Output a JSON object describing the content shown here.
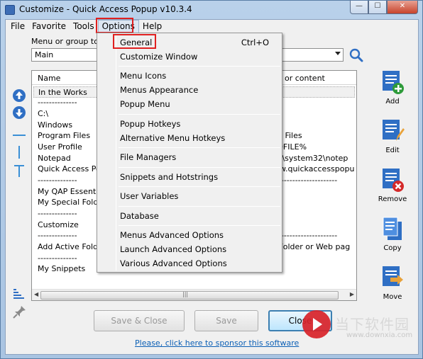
{
  "window": {
    "title": "Customize - Quick Access Popup v10.3.4",
    "min_glyph": "—",
    "max_glyph": "☐",
    "close_glyph": "✕"
  },
  "menubar": [
    "File",
    "Favorite",
    "Tools",
    "Options",
    "Help"
  ],
  "menu_group": {
    "label": "Menu or group to",
    "value": "Main"
  },
  "list": {
    "headers": {
      "name": "Name",
      "content": "or content"
    },
    "rows_name": [
      "In the Works",
      "--------------",
      "C:\\",
      "Windows",
      "Program Files",
      "User Profile",
      "Notepad",
      "Quick Access Po",
      "--------------",
      "My QAP Essenti",
      "My Special Folde",
      "--------------",
      "Customize",
      "--------------",
      "Add Active Folde",
      "--------------",
      "My Snippets"
    ],
    "rows_content": [
      "",
      "",
      "",
      "ows",
      "ram Files",
      "PROFILE%",
      "ows\\system32\\notep",
      "www.quickaccesspopu",
      "-------------------------",
      "",
      "",
      "",
      "ze",
      "-------------------------",
      "ve Folder or Web pag",
      "",
      ""
    ],
    "scroll_grip": "|||"
  },
  "right_tools": [
    "Add",
    "Edit",
    "Remove",
    "Copy",
    "Move"
  ],
  "buttons": {
    "save_close": "Save & Close",
    "save": "Save",
    "close": "Close"
  },
  "sponsor": "Please, click here to sponsor this software",
  "options_menu": {
    "groups": [
      [
        {
          "label": "General",
          "shortcut": "Ctrl+O"
        },
        {
          "label": "Customize Window",
          "shortcut": ""
        }
      ],
      [
        {
          "label": "Menu Icons",
          "shortcut": ""
        },
        {
          "label": "Menus Appearance",
          "shortcut": ""
        },
        {
          "label": "Popup Menu",
          "shortcut": ""
        }
      ],
      [
        {
          "label": "Popup Hotkeys",
          "shortcut": ""
        },
        {
          "label": "Alternative Menu Hotkeys",
          "shortcut": ""
        }
      ],
      [
        {
          "label": "File Managers",
          "shortcut": ""
        }
      ],
      [
        {
          "label": "Snippets and Hotstrings",
          "shortcut": ""
        }
      ],
      [
        {
          "label": "User Variables",
          "shortcut": ""
        }
      ],
      [
        {
          "label": "Database",
          "shortcut": ""
        }
      ],
      [
        {
          "label": "Menus Advanced Options",
          "shortcut": ""
        },
        {
          "label": "Launch Advanced Options",
          "shortcut": ""
        },
        {
          "label": "Various Advanced Options",
          "shortcut": ""
        }
      ]
    ]
  },
  "watermark": {
    "text": "当下软件园",
    "url": "www.downxia.com"
  },
  "colors": {
    "highlight_box": "#e02020",
    "link": "#0b5fb5",
    "icon_blue": "#2f6fc4",
    "add_green": "#2e9b3a",
    "remove_red": "#d42a2a"
  }
}
